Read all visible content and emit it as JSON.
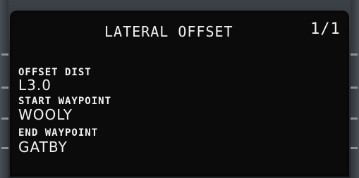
{
  "cdu": {
    "page_title": "LATERAL OFFSET",
    "page_number": "1/1",
    "fields": [
      {
        "label": "OFFSET DIST",
        "value": "L3.0"
      },
      {
        "label": "START WAYPOINT",
        "value": "WOOLY"
      },
      {
        "label": "END WAYPOINT",
        "value": "GATBY"
      }
    ]
  },
  "colors": {
    "screen_background": "#0b0b0b",
    "text": "#f2f2f2",
    "bezel": "#2b2e33"
  }
}
